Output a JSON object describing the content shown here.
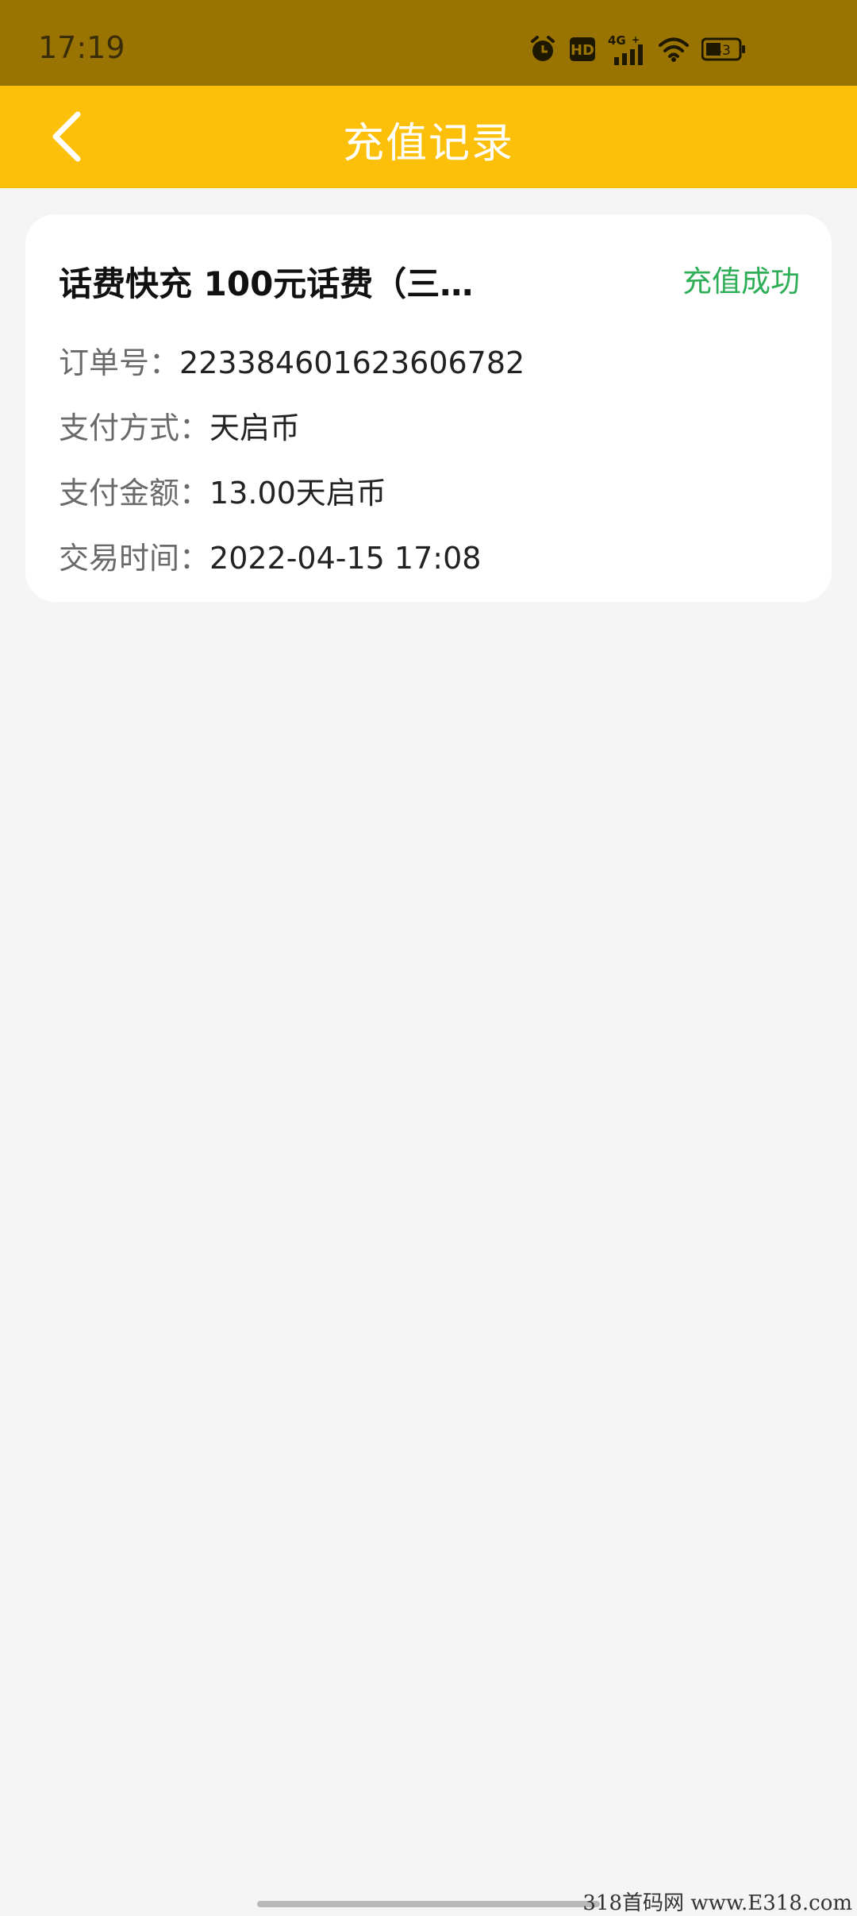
{
  "status_bar": {
    "time": "17:19",
    "network": "4G",
    "hd": "HD",
    "battery": "43",
    "icons": [
      "alarm-icon",
      "hd-icon",
      "signal-4g-icon",
      "wifi-icon",
      "battery-icon"
    ]
  },
  "app_bar": {
    "title": "充值记录",
    "back_icon": "chevron-left-icon"
  },
  "record": {
    "title": "话费快充 100元话费（三…",
    "status": "充值成功",
    "order_label": "订单号：",
    "order_value": "223384601623606782",
    "method_label": "支付方式：",
    "method_value": "天启币",
    "amount_label": "支付金额：",
    "amount_value": "13.00天启币",
    "time_label": "交易时间：",
    "time_value": "2022-04-15 17:08"
  },
  "watermark": "318首码网 www.E318.com",
  "colors": {
    "status_bar_bg": "#9a7402",
    "app_bar_bg": "#fdc00a",
    "page_bg": "#f5f5f5",
    "success_green": "#2eae56"
  }
}
